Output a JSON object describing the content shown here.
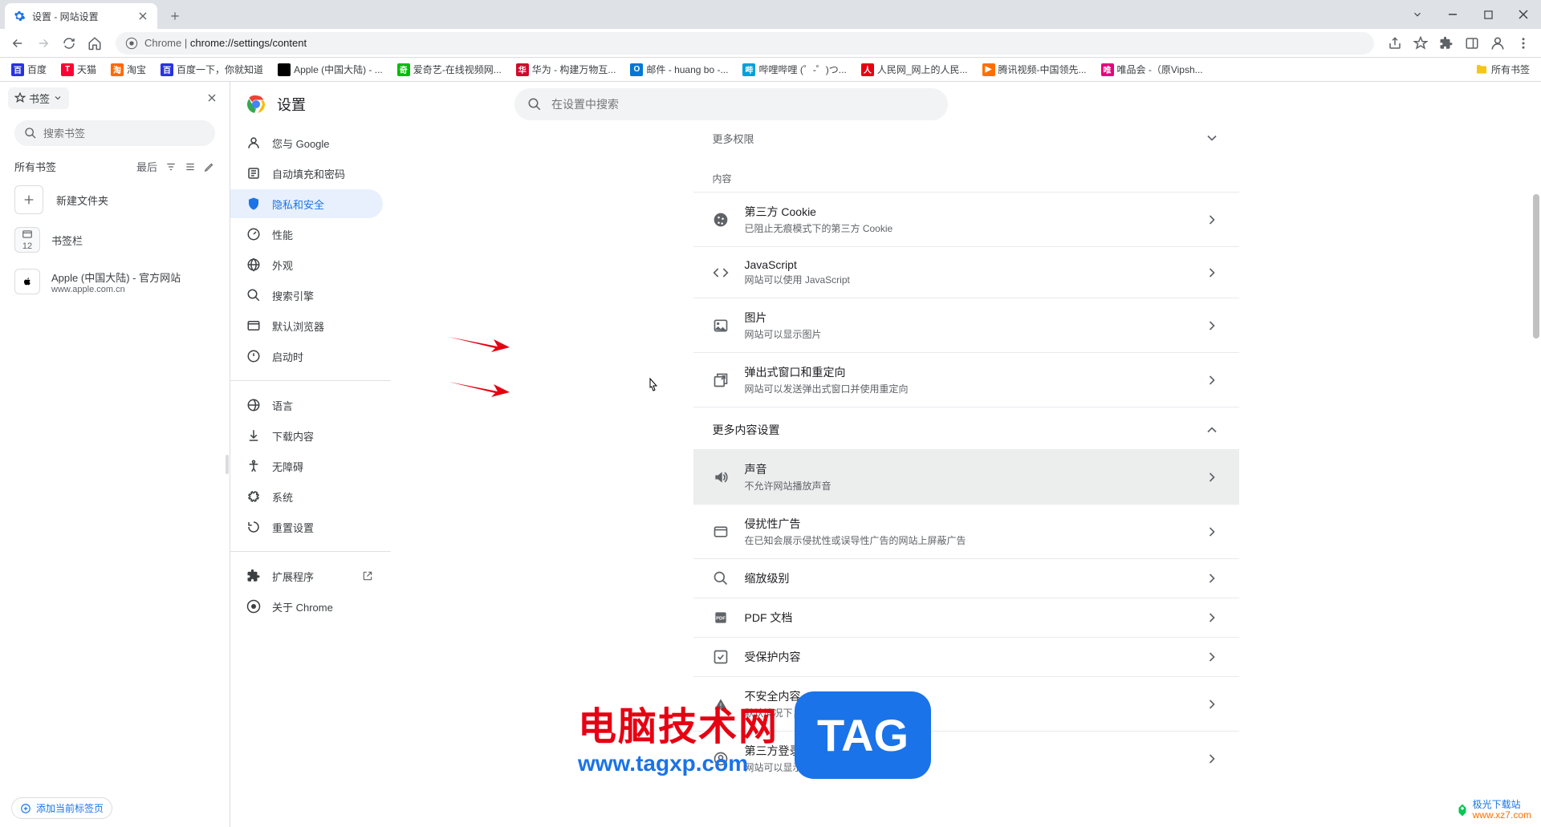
{
  "window": {
    "tab_title": "设置 - 网站设置",
    "url_prefix": "Chrome",
    "url": "chrome://settings/content"
  },
  "bookmarks_bar": {
    "items": [
      {
        "label": "百度",
        "bg": "#2932e1"
      },
      {
        "label": "天猫",
        "bg": "#ff0036"
      },
      {
        "label": "淘宝",
        "bg": "#ff6a00"
      },
      {
        "label": "百度一下，你就知道",
        "bg": "#2932e1"
      },
      {
        "label": "Apple (中国大陆) - ...",
        "bg": "#000"
      },
      {
        "label": "爱奇艺-在线视频网...",
        "bg": "#00be06"
      },
      {
        "label": "华为 - 构建万物互...",
        "bg": "#cf0a2c"
      },
      {
        "label": "邮件 - huang bo -...",
        "bg": "#0078d4"
      },
      {
        "label": "哔哩哔哩 (゜-゜)つ...",
        "bg": "#00a1d6"
      },
      {
        "label": "人民网_网上的人民...",
        "bg": "#e60012"
      },
      {
        "label": "腾讯视频-中国领先...",
        "bg": "#ff6f00"
      },
      {
        "label": "唯品会 -（原Vipsh...",
        "bg": "#e6007e"
      }
    ],
    "all_bookmarks": "所有书签"
  },
  "bm_sidebar": {
    "dropdown": "书签",
    "search_placeholder": "搜索书签",
    "all_bookmarks": "所有书签",
    "recent": "最后",
    "new_folder": "新建文件夹",
    "bookmarks_bar": "书签栏",
    "bookmarks_bar_count": "12",
    "apple_title": "Apple (中国大陆) - 官方网站",
    "apple_url": "www.apple.com.cn",
    "add_current": "添加当前标签页"
  },
  "settings": {
    "title": "设置",
    "search_placeholder": "在设置中搜索",
    "nav": {
      "you_and_google": "您与 Google",
      "autofill": "自动填充和密码",
      "privacy": "隐私和安全",
      "performance": "性能",
      "appearance": "外观",
      "search_engine": "搜索引擎",
      "default_browser": "默认浏览器",
      "on_startup": "启动时",
      "languages": "语言",
      "downloads": "下载内容",
      "accessibility": "无障碍",
      "system": "系统",
      "reset": "重置设置",
      "extensions": "扩展程序",
      "about": "关于 Chrome"
    },
    "content": {
      "more_permissions": "更多权限",
      "content_label": "内容",
      "cookies": {
        "title": "第三方 Cookie",
        "sub": "已阻止无痕模式下的第三方 Cookie"
      },
      "javascript": {
        "title": "JavaScript",
        "sub": "网站可以使用 JavaScript"
      },
      "images": {
        "title": "图片",
        "sub": "网站可以显示图片"
      },
      "popups": {
        "title": "弹出式窗口和重定向",
        "sub": "网站可以发送弹出式窗口并使用重定向"
      },
      "more_content": "更多内容设置",
      "sound": {
        "title": "声音",
        "sub": "不允许网站播放声音"
      },
      "ads": {
        "title": "侵扰性广告",
        "sub": "在已知会展示侵扰性或误导性广告的网站上屏蔽广告"
      },
      "zoom": {
        "title": "缩放级别"
      },
      "pdf": {
        "title": "PDF 文档"
      },
      "protected": {
        "title": "受保护内容"
      },
      "insecure": {
        "title": "不安全内容",
        "sub": "默认情况下，安全网站会拦截不安全内容"
      },
      "federated": {
        "title": "第三方登录",
        "sub": "网站可以显示来自身份服务的登录提示"
      }
    }
  },
  "watermark": {
    "line1": "电脑技术网",
    "line2": "www.tagxp.com",
    "tag": "TAG",
    "corner_name": "极光下载站",
    "corner_url": "www.xz7.com"
  }
}
